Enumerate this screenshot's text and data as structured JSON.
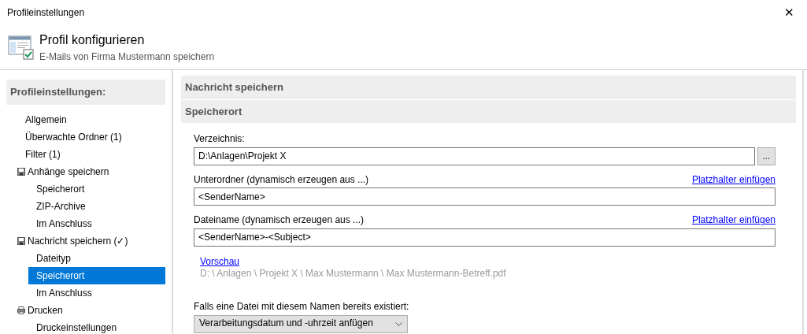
{
  "window": {
    "title": "Profileinstellungen",
    "close": "✕"
  },
  "header": {
    "title": "Profil konfigurieren",
    "subtitle": "E-Mails von Firma Mustermann speichern"
  },
  "sidebar": {
    "title": "Profileinstellungen:",
    "items": [
      {
        "label": "Allgemein",
        "kind": "plain",
        "selected": false
      },
      {
        "label": "Überwachte Ordner (1)",
        "kind": "plain",
        "selected": false
      },
      {
        "label": "Filter (1)",
        "kind": "plain",
        "selected": false
      },
      {
        "label": "Anhänge speichern",
        "kind": "save",
        "selected": false,
        "children": [
          {
            "label": "Speicherort",
            "selected": false
          },
          {
            "label": "ZIP-Archive",
            "selected": false
          },
          {
            "label": "Im Anschluss",
            "selected": false
          }
        ]
      },
      {
        "label": "Nachricht speichern (✓)",
        "kind": "save",
        "selected": false,
        "children": [
          {
            "label": "Dateityp",
            "selected": false
          },
          {
            "label": "Speicherort",
            "selected": true
          },
          {
            "label": "Im Anschluss",
            "selected": false
          }
        ]
      },
      {
        "label": "Drucken",
        "kind": "print",
        "selected": false,
        "children": [
          {
            "label": "Druckeinstellungen",
            "selected": false
          }
        ]
      }
    ]
  },
  "main": {
    "section": "Nachricht speichern",
    "subsection": "Speicherort",
    "fields": [
      {
        "label": "Verzeichnis:",
        "value": "D:\\Anlagen\\Projekt X",
        "browse": "..."
      },
      {
        "label": "Unterordner (dynamisch erzeugen aus ...)",
        "value": "<SenderName>",
        "link": "Platzhalter einfügen"
      },
      {
        "label": "Dateiname (dynamisch erzeugen aus ...)",
        "value": "<SenderName>-<Subject>",
        "link": "Platzhalter einfügen"
      }
    ],
    "preview_link": "Vorschau",
    "preview": "D: \\ Anlagen \\ Projekt X \\ Max Mustermann \\ Max Mustermann-Betreff.pdf",
    "exists_label": "Falls eine Datei mit diesem Namen bereits existiert:",
    "exists_value": "Verarbeitungsdatum und -uhrzeit anfügen"
  }
}
